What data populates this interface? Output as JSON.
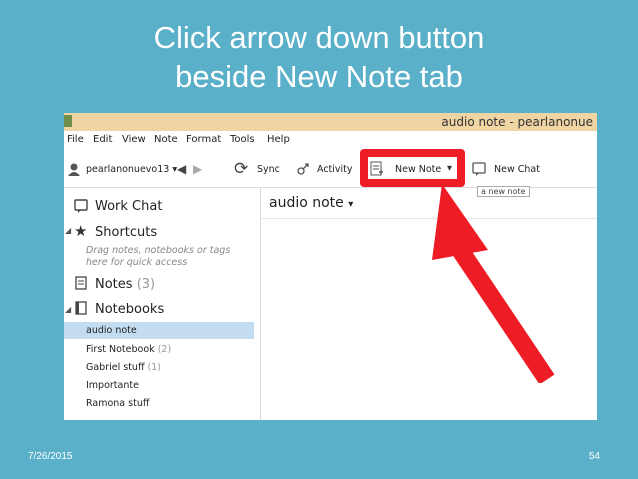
{
  "slide": {
    "title_line1": "Click arrow down button",
    "title_line2": "beside New Note tab",
    "date": "7/26/2015",
    "page_number": "54"
  },
  "window": {
    "title": "audio note - pearlanonue"
  },
  "menu": [
    "File",
    "Edit",
    "View",
    "Note",
    "Format",
    "Tools",
    "Help"
  ],
  "toolbar": {
    "user": "pearlanonuevo13",
    "sync": "Sync",
    "activity": "Activity",
    "new_note": "New Note",
    "new_chat": "New Chat",
    "tooltip": "a new note"
  },
  "sidebar": {
    "work_chat": "Work Chat",
    "shortcuts": "Shortcuts",
    "shortcuts_hint": "Drag notes, notebooks or tags here for quick access",
    "notes": "Notes",
    "notes_count": "(3)",
    "notebooks": "Notebooks",
    "notebook_items": [
      {
        "name": "audio note",
        "count": ""
      },
      {
        "name": "First Notebook",
        "count": "(2)"
      },
      {
        "name": "Gabriel stuff",
        "count": "(1)"
      },
      {
        "name": "Importante",
        "count": ""
      },
      {
        "name": "Ramona stuff",
        "count": ""
      }
    ]
  },
  "main": {
    "notebook_title": "audio note"
  },
  "colors": {
    "background": "#5aafc9",
    "highlight": "#ee1c24",
    "selection": "#c3dcf0"
  }
}
